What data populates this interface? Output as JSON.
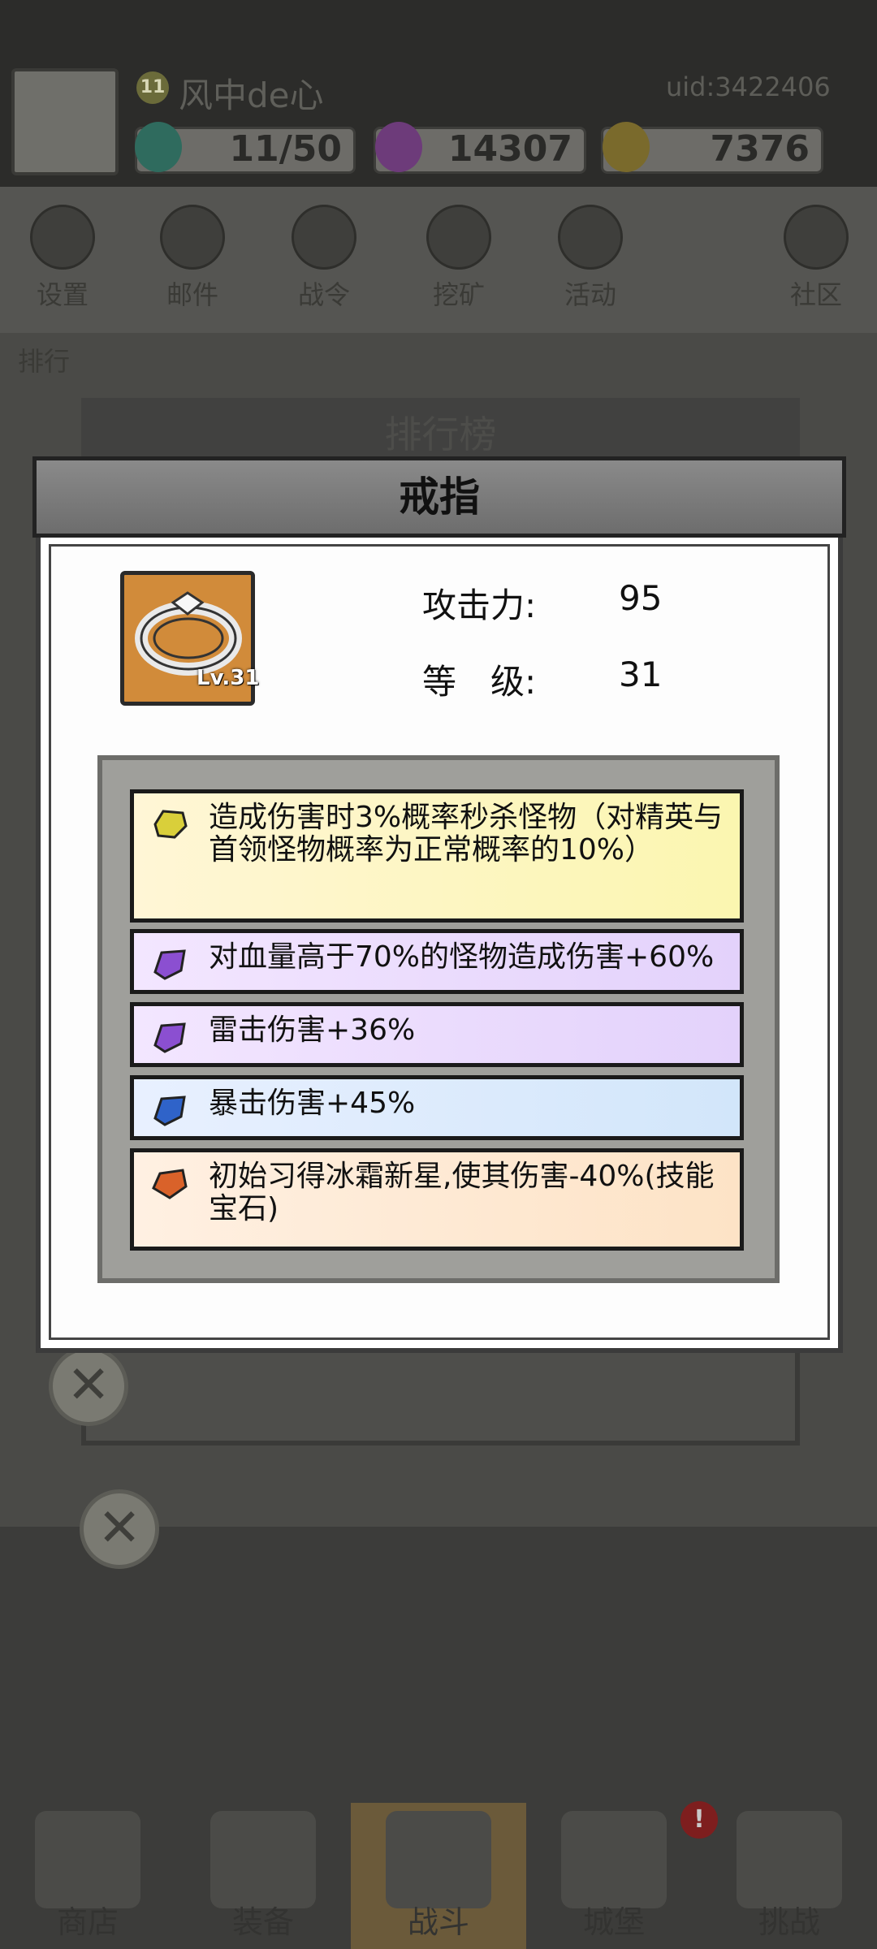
{
  "player": {
    "level": "11",
    "name": "风中de心",
    "uid": "uid:3422406"
  },
  "resources": [
    {
      "name": "energy",
      "value": "11/50",
      "color": "#3fb39a"
    },
    {
      "name": "gems",
      "value": "14307",
      "color": "#b04fd0"
    },
    {
      "name": "coins",
      "value": "7376",
      "color": "#d4a82b"
    }
  ],
  "menu": [
    {
      "label": "设置",
      "icon": "gear-icon"
    },
    {
      "label": "邮件",
      "icon": "mail-icon"
    },
    {
      "label": "战令",
      "icon": "orb-icon"
    },
    {
      "label": "挖矿",
      "icon": "mine-icon"
    },
    {
      "label": "活动",
      "icon": "event-icon"
    },
    {
      "label": "社区",
      "icon": "home-icon"
    }
  ],
  "side_button": {
    "label": "排行"
  },
  "background_panel": {
    "title": "排行榜"
  },
  "dialog": {
    "title": "戒指",
    "item": {
      "icon": "ring-icon",
      "level_badge": "Lv.31"
    },
    "stats": {
      "attack_label": "攻击力:",
      "attack_value": "95",
      "level_label": "等　级:",
      "level_value": "31"
    },
    "affixes": [
      {
        "gem": "yellow-gem-icon",
        "color": "#d9cf3a",
        "text": "造成伤害时3%概率秒杀怪物（对精英与首领怪物概率为正常概率的10%）"
      },
      {
        "gem": "purple-gem-icon",
        "color": "#8b4fd1",
        "text": "对血量高于70%的怪物造成伤害+60%"
      },
      {
        "gem": "purple-gem-icon",
        "color": "#8b4fd1",
        "text": "雷击伤害+36%"
      },
      {
        "gem": "blue-gem-icon",
        "color": "#2f63c9",
        "text": "暴击伤害+45%"
      },
      {
        "gem": "orange-gem-icon",
        "color": "#d9622a",
        "text": "初始习得冰霜新星,使其伤害-40%(技能宝石)"
      }
    ]
  },
  "bottom_nav": [
    {
      "label": "商店",
      "icon": "shop-icon"
    },
    {
      "label": "装备",
      "icon": "backpack-icon"
    },
    {
      "label": "战斗",
      "icon": "swords-icon"
    },
    {
      "label": "城堡",
      "icon": "castle-icon",
      "alert": "!"
    },
    {
      "label": "挑战",
      "icon": "challenge-icon"
    }
  ]
}
